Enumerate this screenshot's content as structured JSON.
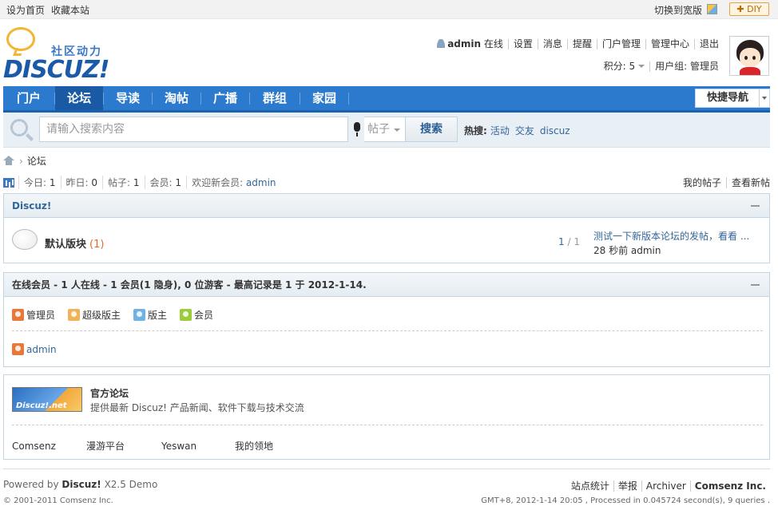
{
  "topbar": {
    "set_home": "设为首页",
    "bookmark": "收藏本站",
    "switch_wide": "切换到宽版",
    "diy": "DIY"
  },
  "logo": {
    "tagline": "社区动力",
    "wordmark": "DISCUZ!"
  },
  "user_nav": {
    "username": "admin",
    "status": "在线",
    "links": [
      "设置",
      "消息",
      "提醒",
      "门户管理",
      "管理中心",
      "退出"
    ]
  },
  "user_info": {
    "credits": "积分: 5",
    "group": "用户组: 管理员"
  },
  "nav": {
    "tabs": [
      {
        "label": "门户",
        "active": false
      },
      {
        "label": "论坛",
        "active": true
      },
      {
        "label": "导读",
        "active": false
      },
      {
        "label": "淘帖",
        "active": false
      },
      {
        "label": "广播",
        "active": false
      },
      {
        "label": "群组",
        "active": false
      },
      {
        "label": "家园",
        "active": false
      }
    ],
    "quick_nav": "快捷导航"
  },
  "search": {
    "placeholder": "请输入搜索内容",
    "scope": "帖子",
    "button": "搜索",
    "hot_label": "热搜:",
    "hot_keywords": [
      "活动",
      "交友",
      "discuz"
    ]
  },
  "breadcrumb": {
    "current": "论坛"
  },
  "stats": {
    "today_label": "今日:",
    "today": "1",
    "yesterday_label": "昨日:",
    "yesterday": "0",
    "posts_label": "帖子:",
    "posts": "1",
    "members_label": "会员:",
    "members": "1",
    "welcome_label": "欢迎新会员:",
    "newest": "admin",
    "my_posts": "我的帖子",
    "new_posts": "查看新帖"
  },
  "forum_group": {
    "title": "Discuz!",
    "forum_name": "默认版块",
    "today_count": "(1)",
    "threads": "1",
    "posts": "1",
    "last_post_title": "测试一下新版本论坛的发帖，看看 ...",
    "last_post_meta": "28 秒前 admin"
  },
  "online": {
    "title": "在线会员 - 1 人在线 - 1 会员(1 隐身), 0 位游客 - 最高记录是 1 于 2012-1-14.",
    "legend": [
      {
        "label": "管理员",
        "color": "#e9773a"
      },
      {
        "label": "超级版主",
        "color": "#f2b25a"
      },
      {
        "label": "版主",
        "color": "#6fb3e4"
      },
      {
        "label": "会员",
        "color": "#9ccc3c"
      }
    ],
    "members": [
      {
        "name": "admin",
        "color": "#e9773a"
      }
    ]
  },
  "friend_links": {
    "banner": "Discuz!.net",
    "title": "官方论坛",
    "description": "提供最新 Discuz! 产品新闻、软件下载与技术交流",
    "links": [
      "Comsenz",
      "漫游平台",
      "Yeswan",
      "我的领地"
    ]
  },
  "footer": {
    "powered_prefix": "Powered by",
    "powered_brand": "Discuz!",
    "powered_suffix": "X2.5 Demo",
    "copyright": "© 2001-2011 Comsenz Inc.",
    "links": [
      "站点统计",
      "举报",
      "Archiver"
    ],
    "company": "Comsenz Inc.",
    "debug": "GMT+8, 2012-1-14 20:05 , Processed in 0.045724 second(s), 9 queries ."
  }
}
